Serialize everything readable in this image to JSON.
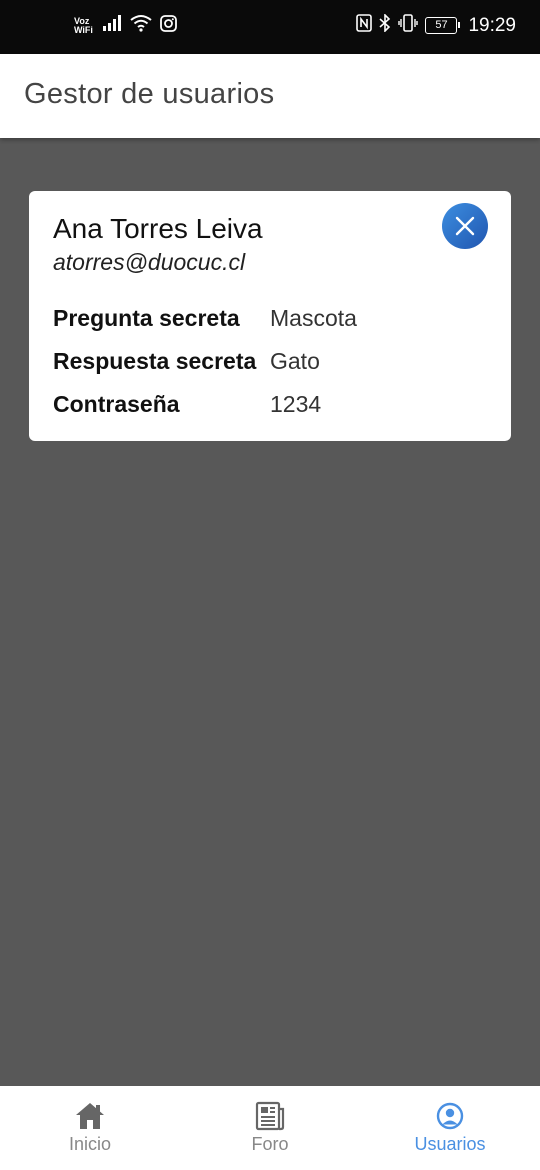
{
  "status_bar": {
    "network_label": "Voz WiFi",
    "battery": "57",
    "time": "19:29"
  },
  "app_bar": {
    "title": "Gestor de usuarios"
  },
  "user_card": {
    "name": "Ana Torres Leiva",
    "email": "atorres@duocuc.cl",
    "fields": [
      {
        "label": "Pregunta secreta",
        "value": "Mascota"
      },
      {
        "label": "Respuesta secreta",
        "value": "Gato"
      },
      {
        "label": "Contraseña",
        "value": "1234"
      }
    ],
    "close_icon": "close-icon",
    "close_color": "#2c6cc4"
  },
  "bottom_nav": {
    "items": [
      {
        "label": "Inicio",
        "icon": "home-icon",
        "active": false
      },
      {
        "label": "Foro",
        "icon": "newspaper-icon",
        "active": false
      },
      {
        "label": "Usuarios",
        "icon": "user-circle-icon",
        "active": true
      }
    ],
    "active_color": "#4a90e2",
    "inactive_color": "#888888"
  }
}
